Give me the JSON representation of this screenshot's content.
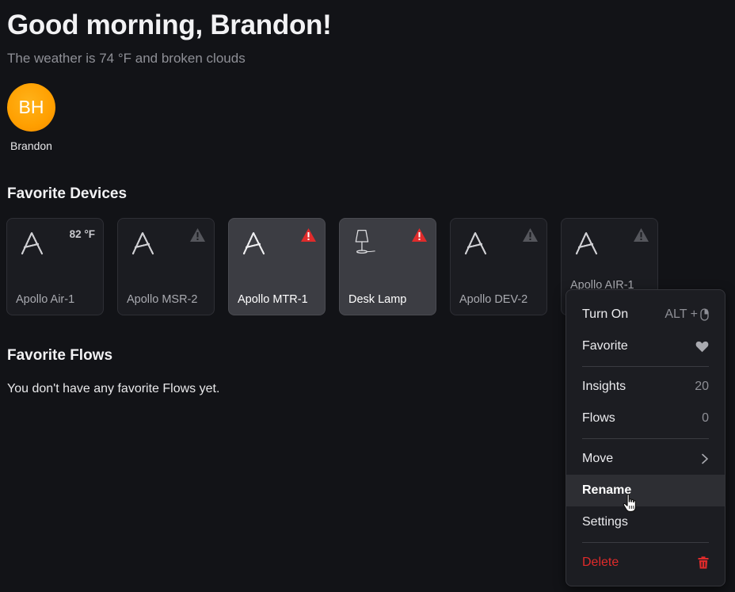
{
  "header": {
    "greeting": "Good morning, Brandon!",
    "weather": "The weather is 74 °F and broken clouds"
  },
  "user": {
    "initials": "BH",
    "name": "Brandon",
    "avatar_color": "#ff9f00"
  },
  "favorite_devices": {
    "title": "Favorite Devices",
    "devices": [
      {
        "name": "Apollo Air-1",
        "badge": "82 °F",
        "icon": "apollo-logo-icon",
        "warning": false,
        "active": false
      },
      {
        "name": "Apollo MSR-2",
        "icon": "apollo-logo-icon",
        "warning": "gray",
        "active": false
      },
      {
        "name": "Apollo MTR-1",
        "icon": "apollo-logo-icon",
        "warning": "red",
        "active": true
      },
      {
        "name": "Desk Lamp",
        "icon": "lamp-icon",
        "warning": "red",
        "active": true
      },
      {
        "name": "Apollo DEV-2",
        "icon": "apollo-logo-icon",
        "warning": "gray",
        "active": false
      },
      {
        "name": "Apollo AIR-1",
        "icon": "apollo-logo-icon",
        "warning": "gray",
        "active": false
      }
    ]
  },
  "favorite_flows": {
    "title": "Favorite Flows",
    "empty_text": "You don't have any favorite Flows yet."
  },
  "context_menu": {
    "turn_on": {
      "label": "Turn On",
      "shortcut": "ALT +",
      "shortcut_icon": "mouse-icon"
    },
    "favorite": {
      "label": "Favorite",
      "icon": "heart-icon"
    },
    "insights": {
      "label": "Insights",
      "count": "20"
    },
    "flows": {
      "label": "Flows",
      "count": "0"
    },
    "move": {
      "label": "Move",
      "icon": "chevron-right-icon"
    },
    "rename": {
      "label": "Rename"
    },
    "settings": {
      "label": "Settings"
    },
    "delete": {
      "label": "Delete",
      "icon": "trash-icon"
    }
  },
  "colors": {
    "background": "#121317",
    "warning_red": "#e02b2b",
    "warning_gray": "#55565c",
    "danger": "#e02b2b"
  }
}
